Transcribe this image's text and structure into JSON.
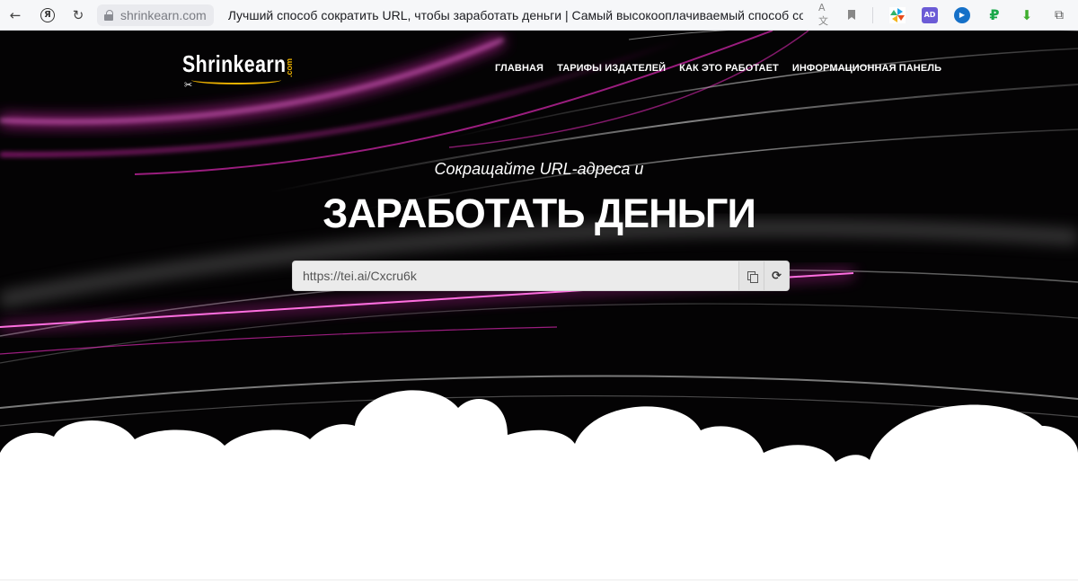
{
  "browser": {
    "domain": "shrinkearn.com",
    "page_title": "Лучший способ сократить URL, чтобы заработать деньги | Самый высокооплачиваемый способ сокр...",
    "ya_label": "Я",
    "translate_label": "A文",
    "extension_icons": [
      "pinwheel-extension-icon",
      "ad-extension-icon",
      "play-extension-icon",
      "ruble-extension-icon",
      "download-extension-icon",
      "shopping-extension-icon"
    ],
    "ext_labels": {
      "ad": "AD",
      "play": "▶",
      "ruble": "₽",
      "download": "⬇",
      "shop": "⧉"
    }
  },
  "site": {
    "logo_text": "Shrinkearn",
    "logo_suffix": ".com",
    "nav": [
      "ГЛАВНАЯ",
      "ТАРИФЫ ИЗДАТЕЛЕЙ",
      "КАК ЭТО РАБОТАЕТ",
      "ИНФОРМАЦИОННАЯ ПАНЕЛЬ"
    ]
  },
  "hero": {
    "subtitle": "Сокращайте URL-адреса и",
    "title": "ЗАРАБОТАТЬ ДЕНЬГИ",
    "short_url": "https://tei.ai/Cxcru6k"
  },
  "colors": {
    "accent_magenta": "#ff2fd0",
    "logo_yellow": "#f0b400",
    "hero_background": "#040304"
  }
}
